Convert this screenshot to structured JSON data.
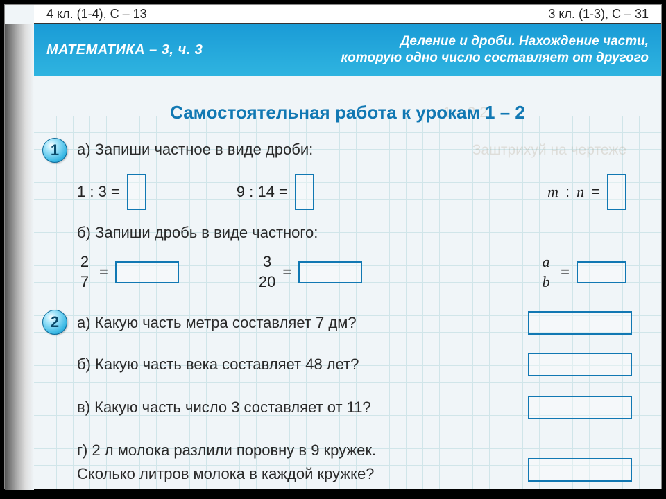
{
  "top": {
    "left": "4 кл. (1-4), С – 13",
    "right": "3 кл. (1-3), С – 31"
  },
  "banner": {
    "subject": "МАТЕМАТИКА – 3, ч. 3",
    "topic1": "Деление и дроби. Нахождение части,",
    "topic2": "которую одно число составляет от другого"
  },
  "title": "Самостоятельная работа к урокам 1 – 2",
  "p1": {
    "num": "1",
    "a_label": "а) Запиши частное в виде дроби:",
    "a_eq1": "1 : 3 =",
    "a_eq2": "9 : 14 =",
    "a_eq3_lhs_m": "m",
    "a_eq3_lhs_colon": " : ",
    "a_eq3_lhs_n": "n",
    "a_eq3_rhs": " =",
    "b_label": "б) Запиши дробь в виде частного:",
    "f1_top": "2",
    "f1_bot": "7",
    "f2_top": "3",
    "f2_bot": "20",
    "f3_top": "a",
    "f3_bot": "b",
    "eqsign": "="
  },
  "p2": {
    "num": "2",
    "a": "а) Какую часть метра составляет 7 дм?",
    "b": "б) Какую часть века составляет 48 лет?",
    "c": "в) Какую часть число 3 составляет от 11?",
    "d1": "г) 2 л молока разлили поровну в 9 кружек.",
    "d2": "Сколько литров молока в каждой кружке?"
  },
  "ghost": {
    "g1": "Заштрихуй на чертеже",
    "g2": "1 – 2  2"
  }
}
